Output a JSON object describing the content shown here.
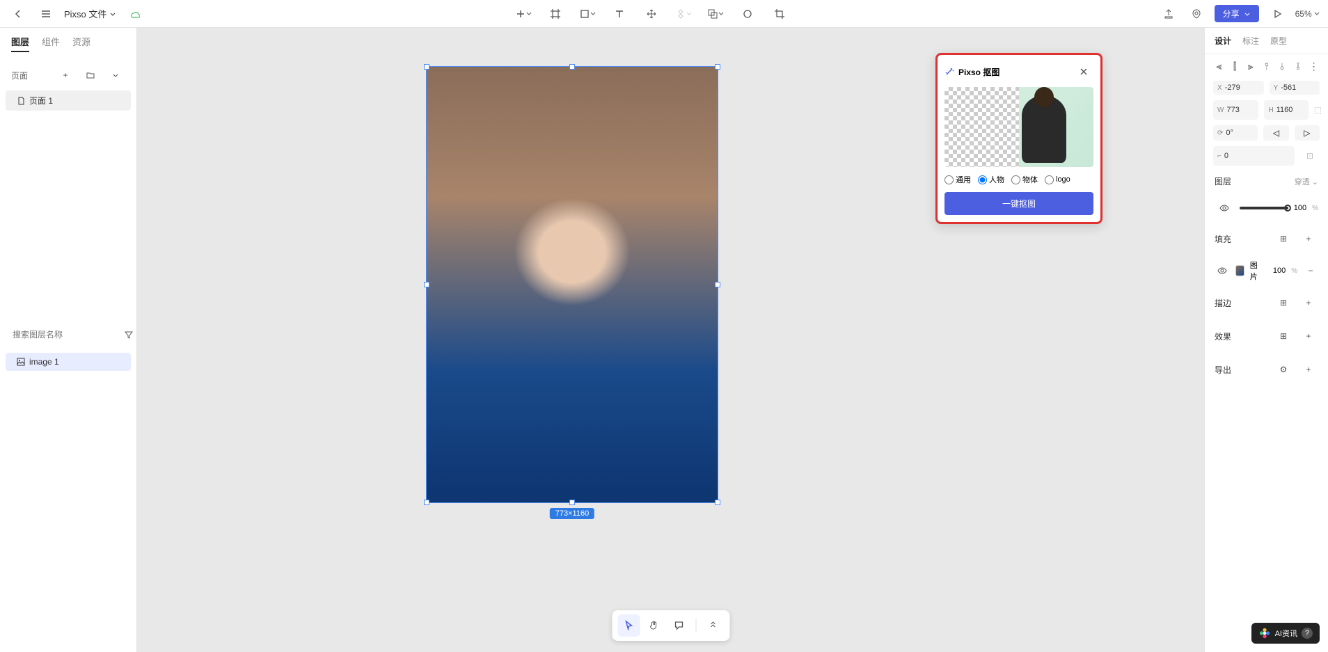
{
  "header": {
    "file_name": "Pixso 文件",
    "share": "分享",
    "zoom": "65%"
  },
  "left": {
    "tabs": [
      "图层",
      "组件",
      "资源"
    ],
    "pages_label": "页面",
    "page_item": "页面 1",
    "search_placeholder": "搜索图层名称",
    "layer_item": "image 1"
  },
  "canvas": {
    "dim_label": "773×1160"
  },
  "floating": {
    "title": "Pixso 抠图",
    "options": {
      "general": "通用",
      "person": "人物",
      "object": "物体",
      "logo": "logo"
    },
    "button": "一键抠图"
  },
  "right": {
    "tabs": [
      "设计",
      "标注",
      "原型"
    ],
    "x_label": "X",
    "x_val": "-279",
    "y_label": "Y",
    "y_val": "-561",
    "w_label": "W",
    "w_val": "773",
    "h_label": "H",
    "h_val": "1160",
    "rot_val": "0°",
    "radius_val": "0",
    "layer_section": "图层",
    "pass_through": "穿透",
    "opacity_val": "100",
    "pct": "%",
    "fill_section": "填充",
    "fill_label": "图片",
    "fill_opacity": "100",
    "stroke_section": "描边",
    "effect_section": "效果",
    "export_section": "导出"
  },
  "badge": {
    "text": "AI资讯",
    "q": "?"
  }
}
